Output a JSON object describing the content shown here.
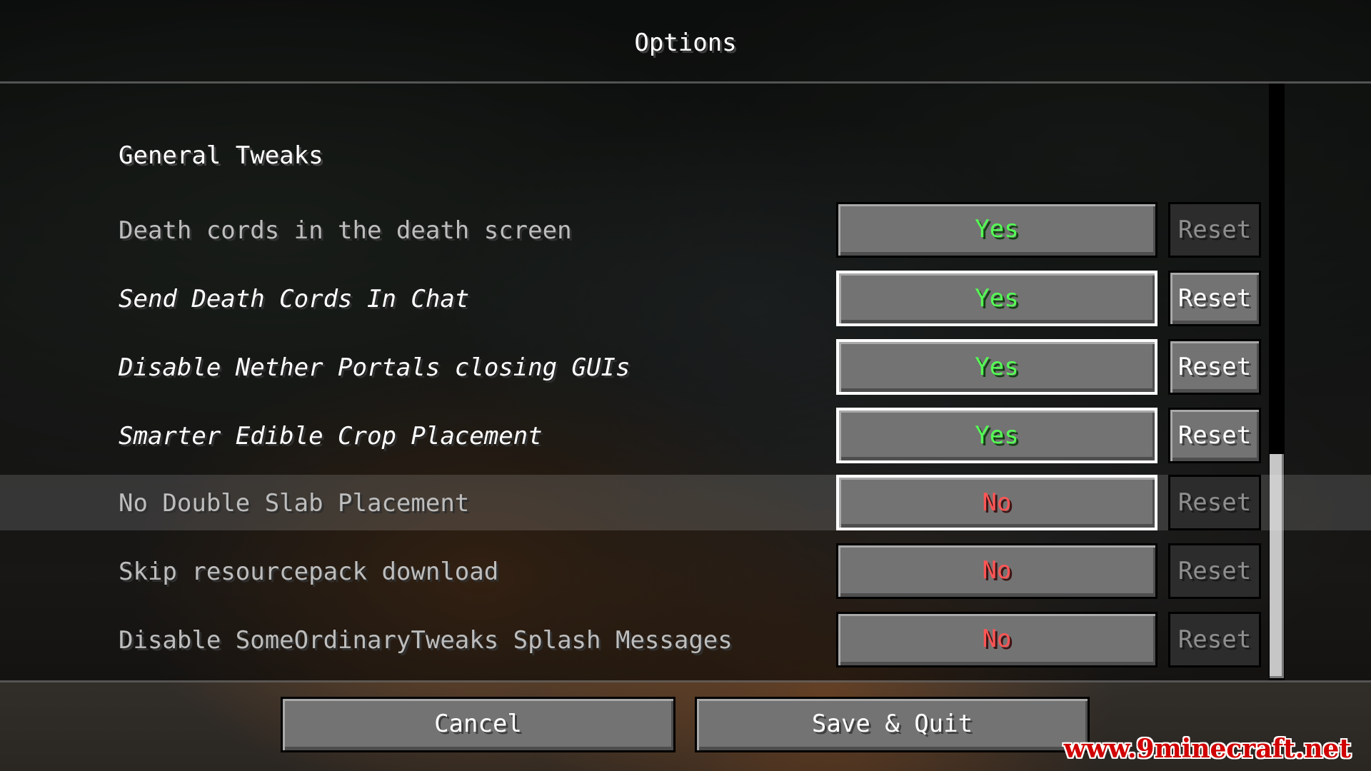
{
  "screen": {
    "title": "Options"
  },
  "section": {
    "title": "General Tweaks"
  },
  "options": [
    {
      "label": "Death cords in the death screen",
      "value": "Yes",
      "reset": "Reset"
    },
    {
      "label": "Send Death Cords In Chat",
      "value": "Yes",
      "reset": "Reset"
    },
    {
      "label": "Disable Nether Portals closing GUIs",
      "value": "Yes",
      "reset": "Reset"
    },
    {
      "label": "Smarter Edible Crop Placement",
      "value": "Yes",
      "reset": "Reset"
    },
    {
      "label": "No Double Slab Placement",
      "value": "No",
      "reset": "Reset"
    },
    {
      "label": "Skip resourcepack download",
      "value": "No",
      "reset": "Reset"
    },
    {
      "label": "Disable SomeOrdinaryTweaks Splash Messages",
      "value": "No",
      "reset": "Reset"
    }
  ],
  "footer": {
    "cancel_label": "Cancel",
    "save_label": "Save & Quit"
  },
  "watermark": "www.9minecraft.net",
  "colors": {
    "yes": "#55ff55",
    "no": "#ff5555",
    "watermark": "#d10000"
  }
}
